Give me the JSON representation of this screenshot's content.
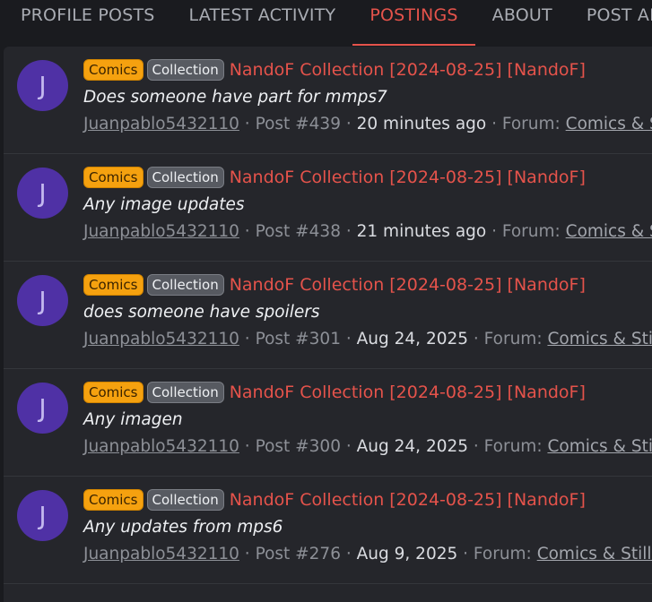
{
  "tabs": [
    {
      "label": "PROFILE POSTS",
      "active": false
    },
    {
      "label": "LATEST ACTIVITY",
      "active": false
    },
    {
      "label": "POSTINGS",
      "active": true
    },
    {
      "label": "ABOUT",
      "active": false
    },
    {
      "label": "POST AR",
      "active": false
    }
  ],
  "colors": {
    "accent": "#e5534b",
    "comics_badge": "#f5a10f",
    "avatar": "#4f31a5"
  },
  "posts": [
    {
      "avatar_letter": "J",
      "badge_primary": "Comics",
      "badge_secondary": "Collection",
      "thread_title": "NandoF Collection [2024-08-25] [NandoF]",
      "snippet": "Does someone have part for mmps7",
      "user": "Juanpablo5432110",
      "sep1": " · ",
      "post_no": "Post #439",
      "sep2": " · ",
      "time": "20 minutes ago",
      "forum_prefix": " · Forum: ",
      "forum": "Comics & Stills"
    },
    {
      "avatar_letter": "J",
      "badge_primary": "Comics",
      "badge_secondary": "Collection",
      "thread_title": "NandoF Collection [2024-08-25] [NandoF]",
      "snippet": "Any image updates",
      "user": "Juanpablo5432110",
      "sep1": " · ",
      "post_no": "Post #438",
      "sep2": " · ",
      "time": "21 minutes ago",
      "forum_prefix": " · Forum: ",
      "forum": "Comics & Stills"
    },
    {
      "avatar_letter": "J",
      "badge_primary": "Comics",
      "badge_secondary": "Collection",
      "thread_title": "NandoF Collection [2024-08-25] [NandoF]",
      "snippet": "does someone have spoilers",
      "user": "Juanpablo5432110",
      "sep1": " · ",
      "post_no": "Post #301",
      "sep2": " · ",
      "time": "Aug 24, 2025",
      "forum_prefix": " · Forum: ",
      "forum": "Comics & Stills"
    },
    {
      "avatar_letter": "J",
      "badge_primary": "Comics",
      "badge_secondary": "Collection",
      "thread_title": "NandoF Collection [2024-08-25] [NandoF]",
      "snippet": "Any imagen",
      "user": "Juanpablo5432110",
      "sep1": " · ",
      "post_no": "Post #300",
      "sep2": " · ",
      "time": "Aug 24, 2025",
      "forum_prefix": " · Forum: ",
      "forum": "Comics & Stills"
    },
    {
      "avatar_letter": "J",
      "badge_primary": "Comics",
      "badge_secondary": "Collection",
      "thread_title": "NandoF Collection [2024-08-25] [NandoF]",
      "snippet": "Any updates from mps6",
      "user": "Juanpablo5432110",
      "sep1": " · ",
      "post_no": "Post #276",
      "sep2": " · ",
      "time": "Aug 9, 2025",
      "forum_prefix": " · Forum: ",
      "forum": "Comics & Stills"
    }
  ]
}
